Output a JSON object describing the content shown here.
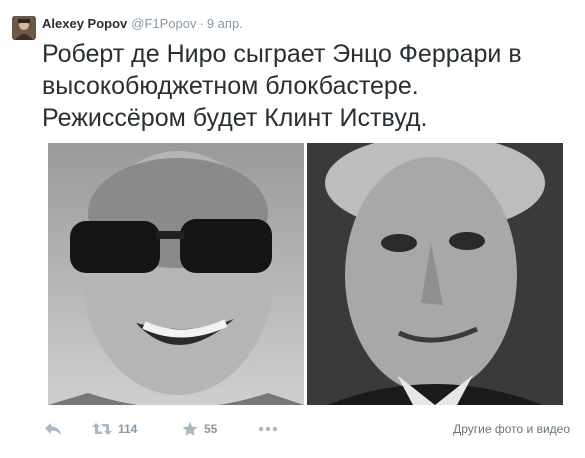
{
  "tweet": {
    "author_name": "Alexey Popov",
    "handle": "@F1Popov",
    "separator": "·",
    "timestamp": "9 апр.",
    "text_lines": [
      "Роберт де Ниро сыграет Энцо Феррари в",
      "высокобюджетном блокбастере.",
      "Режиссёром будет Клинт Иствуд."
    ],
    "media": [
      {
        "icon": "portrait-photo",
        "description_tag": "enzo-ferrari-portrait"
      },
      {
        "icon": "portrait-photo",
        "description_tag": "robert-de-niro-portrait"
      }
    ],
    "actions": {
      "reply_icon": "reply-icon",
      "retweet_count": "114",
      "favorite_count": "55",
      "more_icon": "more-icon",
      "media_link": "Другие фото и видео"
    }
  },
  "colors": {
    "text": "#292f33",
    "secondary": "#8899a6",
    "link": "#66757f",
    "background": "#ffffff"
  }
}
